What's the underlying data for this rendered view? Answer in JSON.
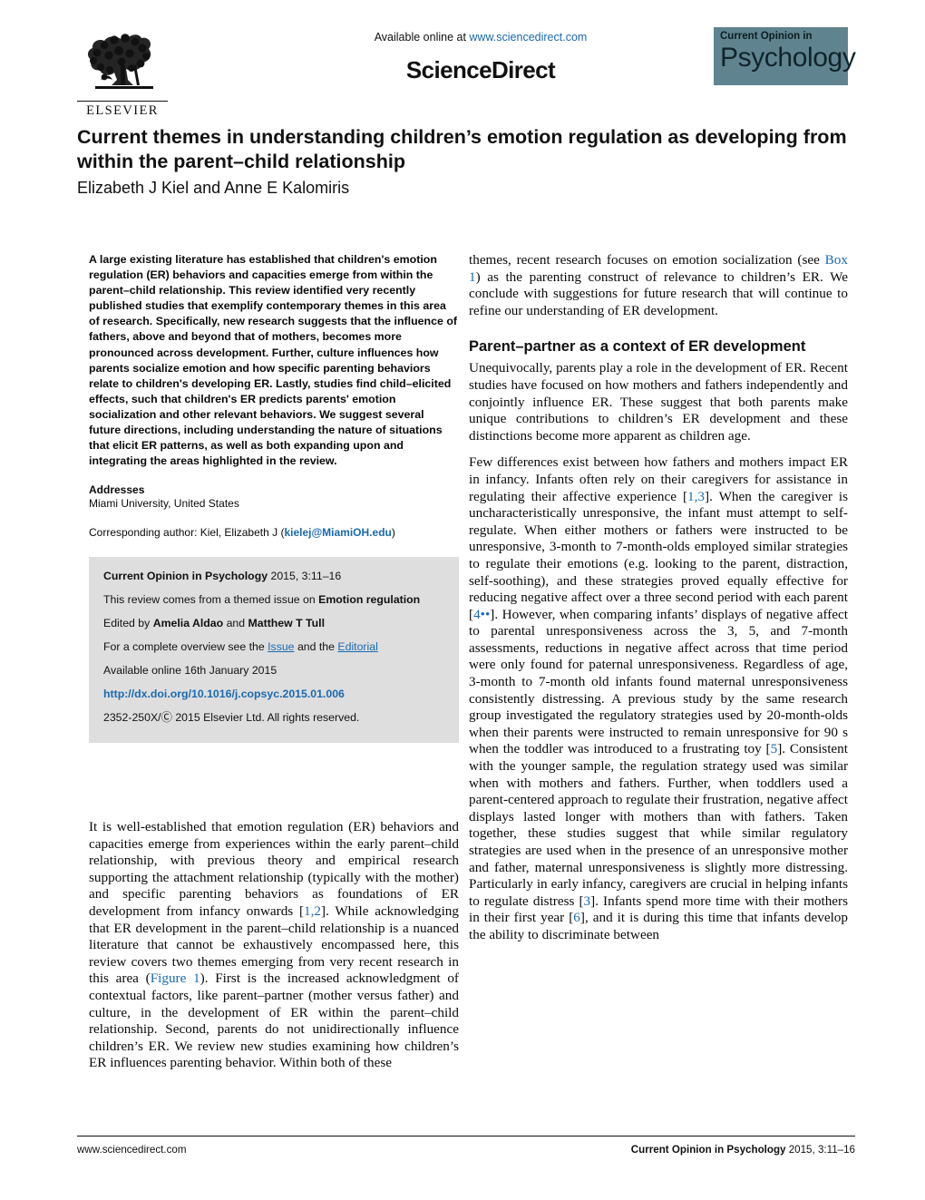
{
  "header": {
    "available_online": "Available online at",
    "sciencedirect_url": "www.sciencedirect.com",
    "sciencedirect_name": "ScienceDirect",
    "elsevier_name": "ELSEVIER",
    "journal_logo_top": "Current Opinion in",
    "journal_logo_main": "Psychology",
    "logo_color": "#5f848f",
    "link_color": "#1a6ab0"
  },
  "article": {
    "title": "Current themes in understanding children’s emotion regulation as developing from within the parent–child relationship",
    "authors": "Elizabeth J Kiel and Anne E Kalomiris"
  },
  "abstract": {
    "text": "A large existing literature has established that children's emotion regulation (ER) behaviors and capacities emerge from within the parent–child relationship. This review identified very recently published studies that exemplify contemporary themes in this area of research. Specifically, new research suggests that the influence of fathers, above and beyond that of mothers, becomes more pronounced across development. Further, culture influences how parents socialize emotion and how specific parenting behaviors relate to children's developing ER. Lastly, studies find child–elicited effects, such that children's ER predicts parents' emotion socialization and other relevant behaviors. We suggest several future directions, including understanding the nature of situations that elicit ER patterns, as well as both expanding upon and integrating the areas highlighted in the review."
  },
  "addresses": {
    "heading": "Addresses",
    "affiliation": "Miami University, United States",
    "corresponding_prefix": "Corresponding author: Kiel, Elizabeth J (",
    "corresponding_email": "kielej@MiamiOH.edu",
    "corresponding_suffix": ")"
  },
  "infobox": {
    "journal_name": "Current Opinion in Psychology",
    "citation": " 2015, 3:11–16",
    "themed_prefix": "This review comes from a themed issue on ",
    "themed_topic": "Emotion regulation",
    "edited_prefix": "Edited by ",
    "editor_1": "Amelia Aldao",
    "edited_mid": " and ",
    "editor_2": "Matthew T Tull",
    "overview_prefix": "For a complete overview see the ",
    "overview_link_1": "Issue",
    "overview_mid": " and the ",
    "overview_link_2": "Editorial",
    "available_online": "Available online 16th January 2015",
    "doi": "http://dx.doi.org/10.1016/j.copsyc.2015.01.006",
    "copyright_issn": "2352-250X/",
    "copyright_symbol": "Ⓒ",
    "copyright_rest": " 2015 Elsevier Ltd. All rights reserved."
  },
  "left_column": {
    "paragraph_1_a": "It is well-established that emotion regulation (ER) behaviors and capacities emerge from experiences within the early parent–child relationship, with previous theory and empirical research supporting the attachment relationship (typically with the mother) and specific parenting behaviors as foundations of ER development from infancy onwards [",
    "cite_1": "1,2",
    "paragraph_1_b": "]. While acknowledging that ER development in the parent–child relationship is a nuanced literature that cannot be exhaustively encompassed here, this review covers two themes emerging from very recent research in this area (",
    "cite_fig": "Figure 1",
    "paragraph_1_c": "). First is the increased acknowledgment of contextual factors, like parent–partner (mother versus father) and culture, in the development of ER within the parent–child relationship. Second, parents do not unidirectionally influence children’s ER. We review new studies examining how children’s ER influences parenting behavior. Within both of these"
  },
  "right_column": {
    "continuation_a": "themes, recent research focuses on emotion socialization (see ",
    "continuation_box": "Box 1",
    "continuation_b": ") as the parenting construct of relevance to children’s ER. We conclude with suggestions for future research that will continue to refine our understanding of ER development.",
    "section_heading": "Parent–partner as a context of ER development",
    "paragraph_1": "Unequivocally, parents play a role in the development of ER. Recent studies have focused on how mothers and fathers independently and conjointly influence ER. These suggest that both parents make unique contributions to children’s ER development and these distinctions become more apparent as children age.",
    "paragraph_2_a": "Few differences exist between how fathers and mothers impact ER in infancy. Infants often rely on their caregivers for assistance in regulating their affective experience [",
    "cite_13": "1,3",
    "paragraph_2_b": "]. When the caregiver is uncharacteristically unresponsive, the infant must attempt to self-regulate. When either mothers or fathers were instructed to be unresponsive, 3-month to 7-month-olds employed similar strategies to regulate their emotions (e.g. looking to the parent, distraction, self-soothing), and these strategies proved equally effective for reducing negative affect over a three second period with each parent [",
    "cite_4": "4••",
    "paragraph_2_c": "]. However, when comparing infants’ displays of negative affect to parental unresponsiveness across the 3, 5, and 7-month assessments, reductions in negative affect across that time period were only found for paternal unresponsiveness. Regardless of age, 3-month to 7-month old infants found maternal unresponsiveness consistently distressing. A previous study by the same research group investigated the regulatory strategies used by 20-month-olds when their parents were instructed to remain unresponsive for 90 s when the toddler was introduced to a frustrating toy [",
    "cite_5": "5",
    "paragraph_2_d": "]. Consistent with the younger sample, the regulation strategy used was similar when with mothers and fathers. Further, when toddlers used a parent-centered approach to regulate their frustration, negative affect displays lasted longer with mothers than with fathers. Taken together, these studies suggest that while similar regulatory strategies are used when in the presence of an unresponsive mother and father, maternal unresponsiveness is slightly more distressing. Particularly in early infancy, caregivers are crucial in helping infants to regulate distress [",
    "cite_3": "3",
    "paragraph_2_e": "]. Infants spend more time with their mothers in their first year [",
    "cite_6": "6",
    "paragraph_2_f": "], and it is during this time that infants develop the ability to discriminate between"
  },
  "footer": {
    "left": "www.sciencedirect.com",
    "right_bold": "Current Opinion in Psychology",
    "right_light": " 2015, 3:11–16"
  }
}
